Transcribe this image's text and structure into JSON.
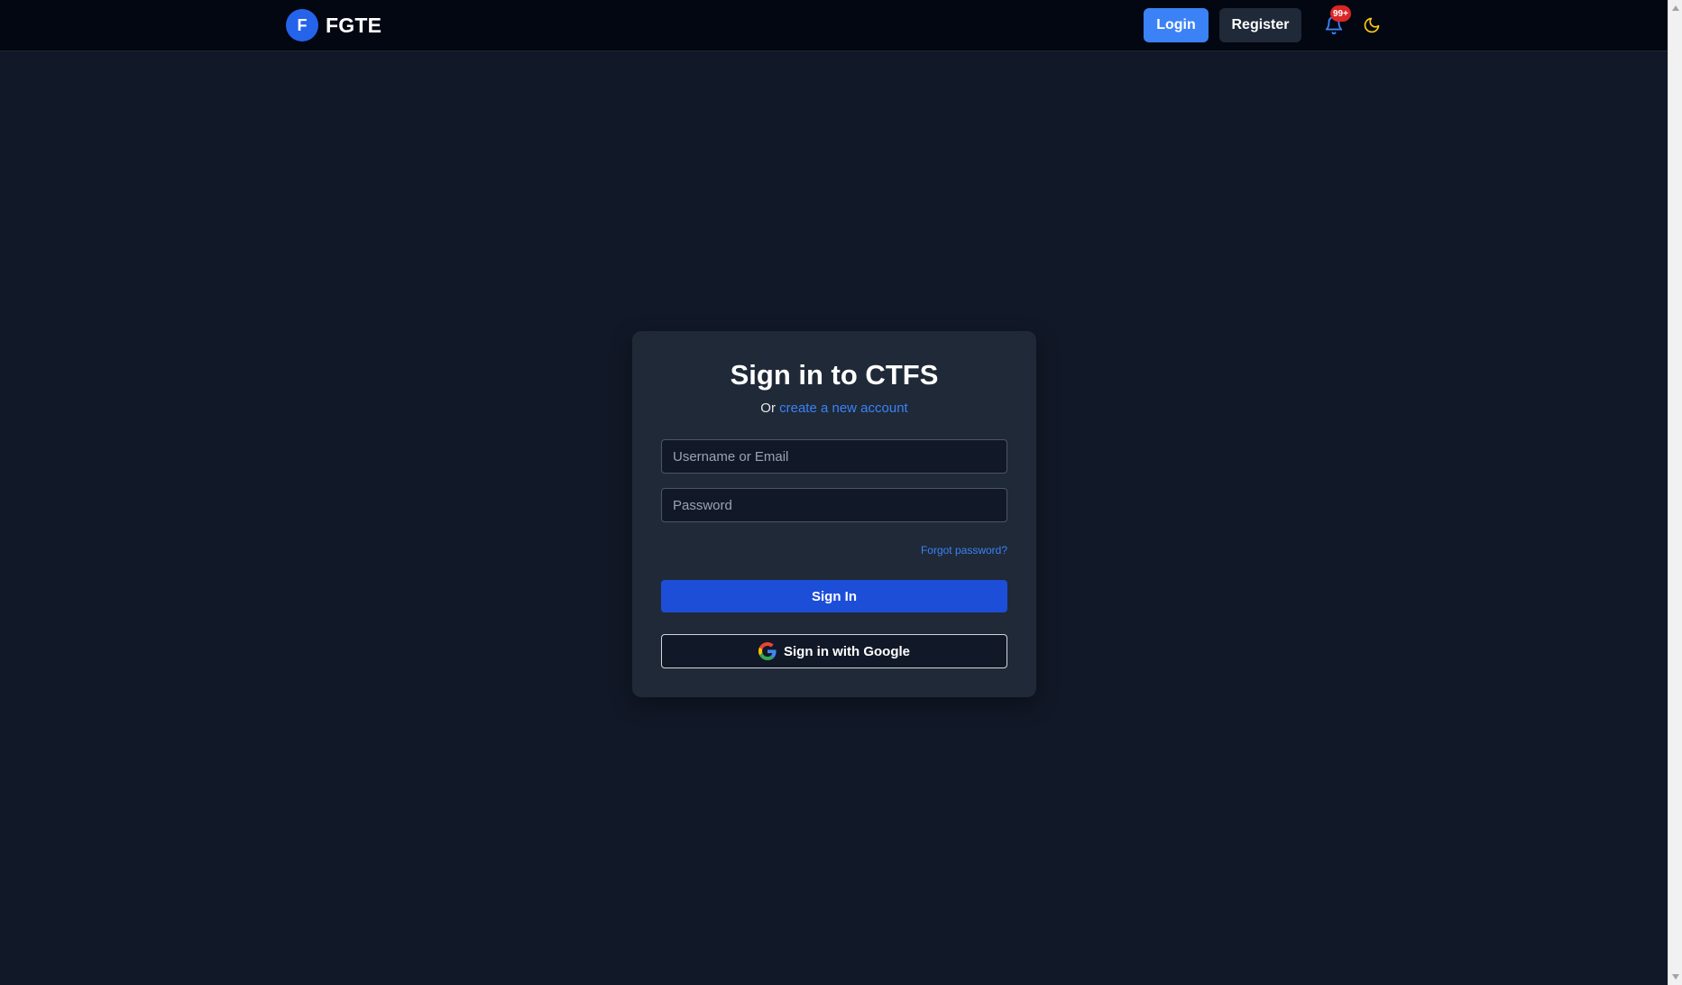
{
  "header": {
    "brand_letter": "F",
    "brand_name": "FGTE",
    "login_label": "Login",
    "register_label": "Register",
    "notification_badge": "99+",
    "icons": [
      "bell-icon",
      "moon-icon"
    ]
  },
  "login": {
    "title": "Sign in to CTFS",
    "subtitle_prefix": "Or",
    "create_account_link": "create a new account",
    "username_placeholder": "Username or Email",
    "password_placeholder": "Password",
    "forgot_password": "Forgot password?",
    "signin_label": "Sign In",
    "google_label": "Sign in with Google",
    "google_icon": "google-icon"
  },
  "colors": {
    "background": "#111827",
    "header_bg": "#030712",
    "card_bg": "#1f2937",
    "accent": "#3b82f6",
    "primary_button": "#1d4ed8",
    "badge": "#dc2626",
    "moon": "#facc15"
  }
}
